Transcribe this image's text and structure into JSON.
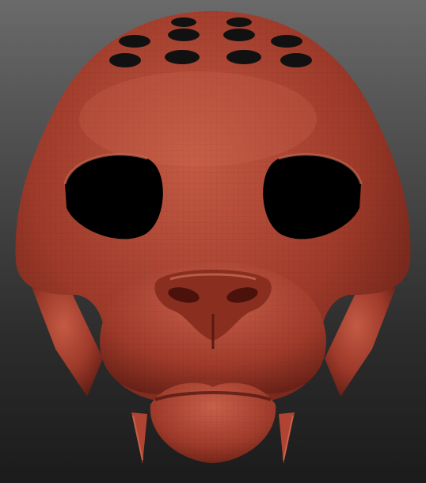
{
  "scene": {
    "subject": "",
    "colors": {
      "background_top": "#6a6a6a",
      "background_bottom": "#1b1b1b",
      "clay_base": "#9e3a2a",
      "clay_highlight": "#c45a44",
      "clay_shadow": "#5a1a12",
      "void": "#000000"
    }
  }
}
